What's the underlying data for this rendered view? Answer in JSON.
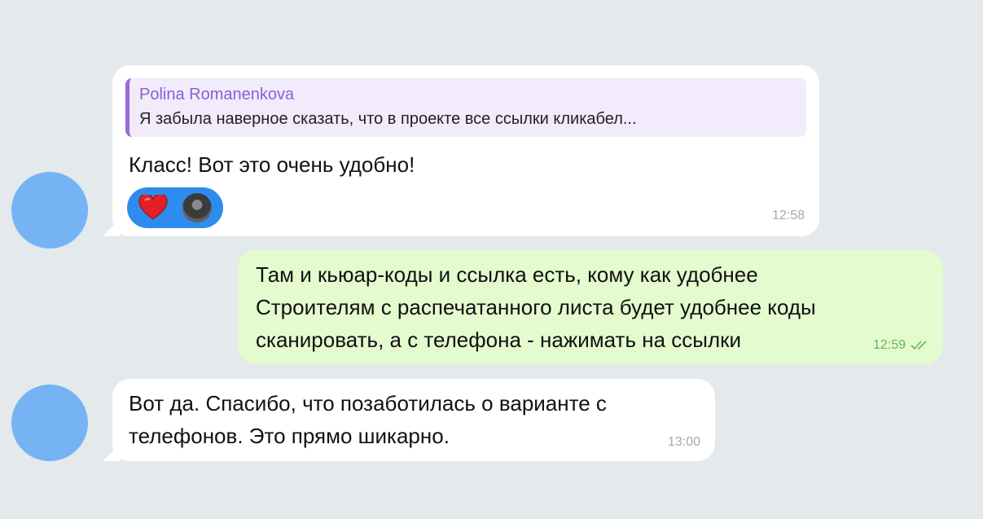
{
  "messages": [
    {
      "reply": {
        "author": "Polina Romanenkova",
        "text": "Я забыла наверное сказать, что в проекте все ссылки кликабел..."
      },
      "text": "Класс! Вот это очень удобно!",
      "reaction": {
        "emoji": "heart-icon",
        "count_avatars": 1
      },
      "time": "12:58"
    },
    {
      "lines": [
        "Там и кьюар-коды и ссылка есть, кому как удобнее",
        "Строителям с распечатанного листа будет удобнее коды",
        "сканировать, а с телефона - нажимать на ссылки"
      ],
      "time": "12:59",
      "status": "read"
    },
    {
      "lines": [
        "Вот да. Спасибо, что позаботилась о варианте с",
        "телефонов. Это прямо шикарно."
      ],
      "time": "13:00"
    }
  ],
  "colors": {
    "background": "#e4e9ec",
    "incoming_bubble": "#ffffff",
    "outgoing_bubble": "#e3fbcf",
    "avatar": "#76b3f4",
    "reply_accent": "#9a6ad8",
    "reaction_pill": "#2e8cef"
  }
}
